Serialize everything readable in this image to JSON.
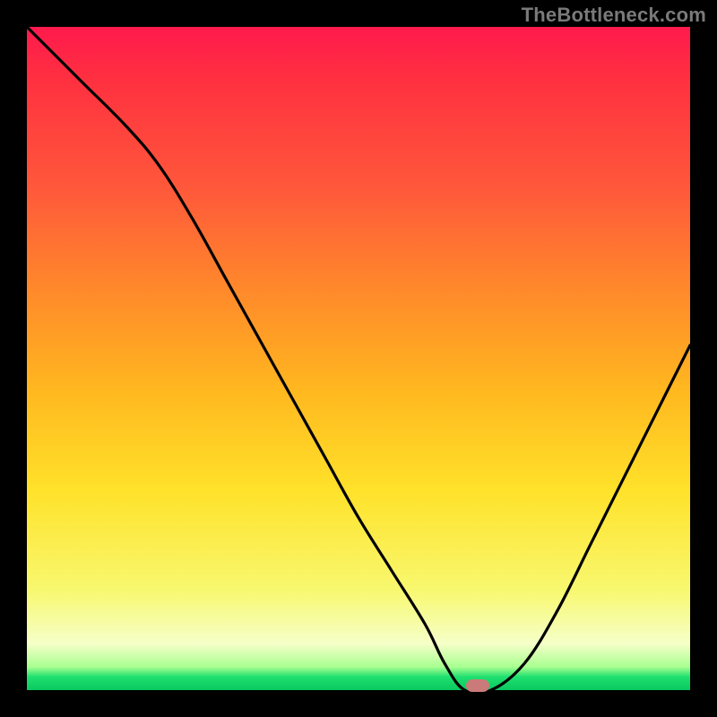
{
  "watermark": "TheBottleneck.com",
  "colors": {
    "frame_bg": "#000000",
    "gradient_top": "#ff1a4d",
    "gradient_bottom": "#08c860",
    "curve": "#000000",
    "marker": "#cb7a7a",
    "watermark_text": "#7a7a7a"
  },
  "chart_data": {
    "type": "line",
    "title": "",
    "xlabel": "",
    "ylabel": "",
    "xlim": [
      0,
      100
    ],
    "ylim": [
      0,
      100
    ],
    "series": [
      {
        "name": "bottleneck-curve",
        "x": [
          0,
          8,
          15,
          20,
          25,
          30,
          35,
          40,
          45,
          50,
          55,
          60,
          63,
          66,
          70,
          75,
          80,
          85,
          90,
          95,
          100
        ],
        "y": [
          100,
          92,
          85,
          79,
          71,
          62,
          53,
          44,
          35,
          26,
          18,
          10,
          4,
          0,
          0,
          4,
          12,
          22,
          32,
          42,
          52
        ]
      }
    ],
    "marker": {
      "x": 68,
      "y": 0
    },
    "grid": false,
    "legend": false,
    "notes": "y = 100 is top of gradient (max bottleneck, red); y = 0 is bottom (optimal, green). Values estimated from pixel heights."
  }
}
